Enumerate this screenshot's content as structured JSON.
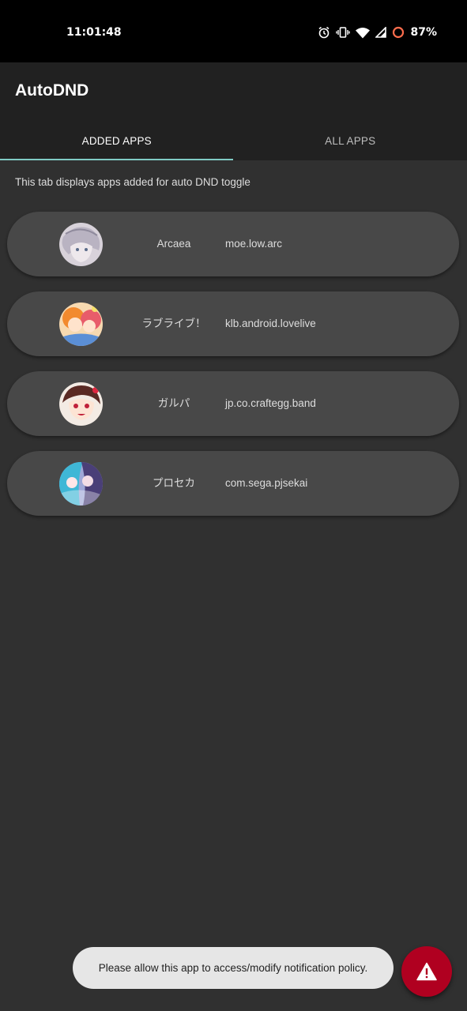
{
  "status_bar": {
    "time": "11:01:48",
    "battery": "87%",
    "icons": [
      "alarm-icon",
      "vibrate-icon",
      "wifi-icon",
      "signal-icon",
      "battery-ring-icon"
    ]
  },
  "app_bar": {
    "title": "AutoDND",
    "tabs": [
      {
        "label": "ADDED APPS",
        "active": true
      },
      {
        "label": "ALL APPS",
        "active": false
      }
    ],
    "accent_color": "#80cbc4"
  },
  "content": {
    "description": "This tab displays apps added for auto DND toggle",
    "apps": [
      {
        "name": "Arcaea",
        "package": "moe.low.arc",
        "icon": "arcaea-app-icon"
      },
      {
        "name": "ラブライブ！",
        "package": "klb.android.lovelive",
        "icon": "lovelive-app-icon"
      },
      {
        "name": "ガルパ",
        "package": "jp.co.craftegg.band",
        "icon": "garupa-app-icon"
      },
      {
        "name": "プロセカ",
        "package": "com.sega.pjsekai",
        "icon": "pjsekai-app-icon"
      }
    ]
  },
  "toast": {
    "message": "Please allow this app to access/modify notification policy."
  },
  "fab": {
    "icon": "warning-icon",
    "color": "#b00020"
  }
}
